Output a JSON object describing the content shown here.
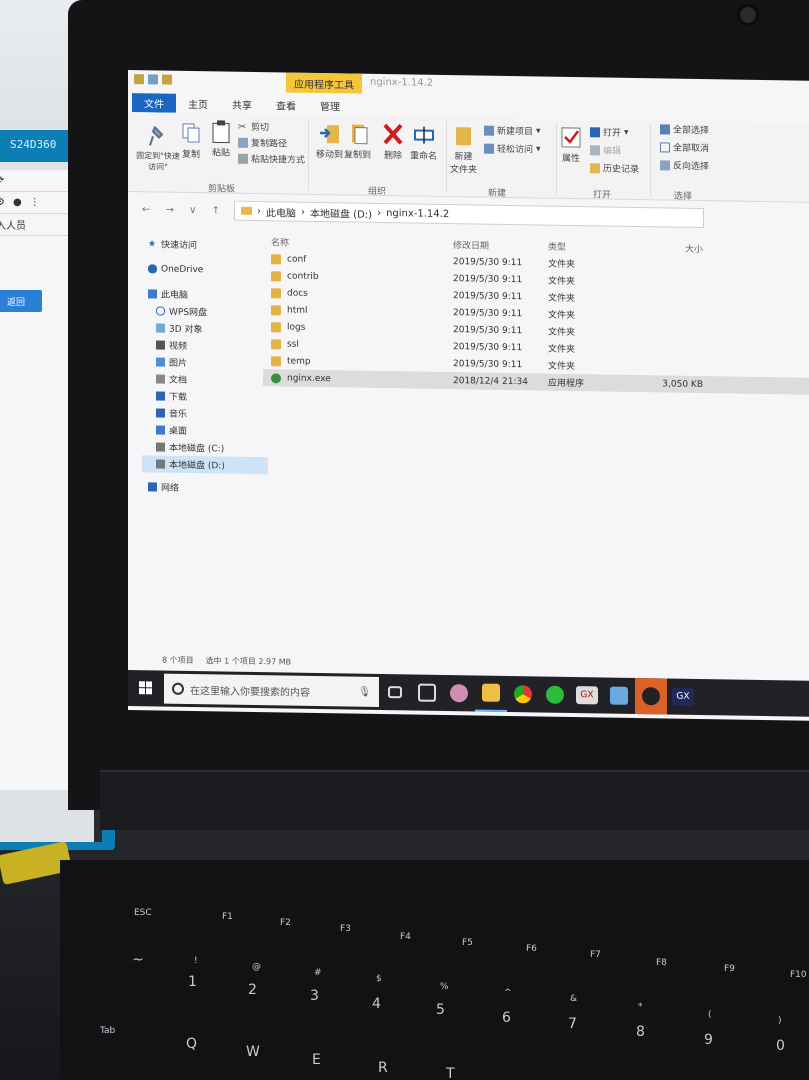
{
  "bg_monitor": {
    "brand": "S24D360",
    "partial_text": "入人员",
    "button": "返回"
  },
  "window": {
    "title_tab_context": "应用程序工具",
    "title_tab_name": "nginx-1.14.2",
    "ribbon_tabs": [
      "文件",
      "主页",
      "共享",
      "查看",
      "管理"
    ]
  },
  "ribbon": {
    "clipboard": {
      "pin_label": "固定到\"快速访问\"",
      "copy_label": "复制",
      "paste_label": "粘贴",
      "cut_label": "剪切",
      "copy_path_label": "复制路径",
      "paste_shortcut_label": "粘贴快捷方式",
      "group": "剪贴板"
    },
    "organize": {
      "move_label": "移动到",
      "copy_to_label": "复制到",
      "delete_label": "删除",
      "rename_label": "重命名",
      "group": "组织"
    },
    "new": {
      "new_folder_label": "新建\n文件夹",
      "new_item_label": "新建项目",
      "easy_access_label": "轻松访问",
      "group": "新建"
    },
    "open": {
      "properties_label": "属性",
      "open_label": "打开",
      "edit_label": "编辑",
      "history_label": "历史记录",
      "group": "打开"
    },
    "select": {
      "select_all": "全部选择",
      "select_none": "全部取消",
      "invert": "反向选择",
      "group": "选择"
    }
  },
  "address": {
    "nav": "← → ∨ ↑",
    "path": [
      "此电脑",
      "本地磁盘 (D:)",
      "nginx-1.14.2"
    ]
  },
  "nav_pane": {
    "items": [
      {
        "label": "快速访问"
      },
      {
        "label": "OneDrive"
      },
      {
        "label": "此电脑"
      },
      {
        "label": "WPS网盘"
      },
      {
        "label": "3D 对象"
      },
      {
        "label": "视频"
      },
      {
        "label": "图片"
      },
      {
        "label": "文档"
      },
      {
        "label": "下载"
      },
      {
        "label": "音乐"
      },
      {
        "label": "桌面"
      },
      {
        "label": "本地磁盘 (C:)"
      },
      {
        "label": "本地磁盘 (D:)"
      },
      {
        "label": "网络"
      }
    ]
  },
  "file_list": {
    "headers": {
      "name": "名称",
      "date": "修改日期",
      "type": "类型",
      "size": "大小"
    },
    "rows": [
      {
        "name": "conf",
        "date": "2019/5/30 9:11",
        "type": "文件夹",
        "size": ""
      },
      {
        "name": "contrib",
        "date": "2019/5/30 9:11",
        "type": "文件夹",
        "size": ""
      },
      {
        "name": "docs",
        "date": "2019/5/30 9:11",
        "type": "文件夹",
        "size": ""
      },
      {
        "name": "html",
        "date": "2019/5/30 9:11",
        "type": "文件夹",
        "size": ""
      },
      {
        "name": "logs",
        "date": "2019/5/30 9:11",
        "type": "文件夹",
        "size": ""
      },
      {
        "name": "ssl",
        "date": "2019/5/30 9:11",
        "type": "文件夹",
        "size": ""
      },
      {
        "name": "temp",
        "date": "2019/5/30 9:11",
        "type": "文件夹",
        "size": ""
      },
      {
        "name": "nginx.exe",
        "date": "2018/12/4 21:34",
        "type": "应用程序",
        "size": "3,050 KB"
      }
    ]
  },
  "status": {
    "count": "8 个项目",
    "selected": "选中 1 个项目 2.97 MB"
  },
  "taskbar": {
    "search_placeholder": "在这里输入你要搜索的内容",
    "apps": [
      "task-view",
      "photos",
      "paint",
      "explorer",
      "chrome",
      "wechat",
      "gx1",
      "notepad",
      "media",
      "gx2"
    ],
    "app_labels": {
      "gx1": "GX",
      "gx2": "GX"
    }
  },
  "keyboard": {
    "function_keys": [
      "ESC",
      "F1",
      "F2",
      "F3",
      "F4",
      "F5",
      "F6",
      "F7",
      "F8",
      "F9",
      "F10"
    ],
    "number_row": [
      "~",
      "1",
      "2",
      "3",
      "4",
      "5",
      "6",
      "7",
      "8",
      "9",
      "0"
    ],
    "number_shift": [
      "",
      "!",
      "@",
      "#",
      "$",
      "%",
      "^",
      "&",
      "*",
      "(",
      ")"
    ],
    "letter_row": [
      "Tab",
      "Q",
      "W",
      "E",
      "R",
      "T"
    ]
  }
}
